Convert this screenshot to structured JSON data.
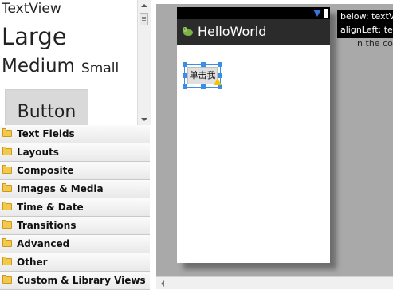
{
  "palette": {
    "preview": {
      "textview": "TextView",
      "large": "Large",
      "medium": "Medium",
      "small": "Small",
      "button": "Button"
    },
    "categories": [
      {
        "label": "Text Fields",
        "icon": "folder-icon"
      },
      {
        "label": "Layouts",
        "icon": "folder-icon"
      },
      {
        "label": "Composite",
        "icon": "folder-icon"
      },
      {
        "label": "Images & Media",
        "icon": "folder-icon"
      },
      {
        "label": "Time & Date",
        "icon": "folder-icon"
      },
      {
        "label": "Transitions",
        "icon": "folder-icon"
      },
      {
        "label": "Advanced",
        "icon": "folder-icon"
      },
      {
        "label": "Other",
        "icon": "folder-icon"
      },
      {
        "label": "Custom & Library Views",
        "icon": "folder-icon"
      }
    ]
  },
  "device": {
    "app_title": "HelloWorld",
    "button_label": "单击我",
    "status_icons": [
      "wifi-icon",
      "battery-icon"
    ],
    "warning_icon": "warning-icon"
  },
  "tooltip": {
    "line1": "below: textV",
    "line2": "alignLeft: tex",
    "line3": "in the cor"
  },
  "colors": {
    "selection": "#3a8ee6",
    "statusbar": "#000000",
    "titlebar": "#2b2b2b",
    "canvas_bg": "#a9a9a9",
    "folder": "#f2c94c"
  }
}
